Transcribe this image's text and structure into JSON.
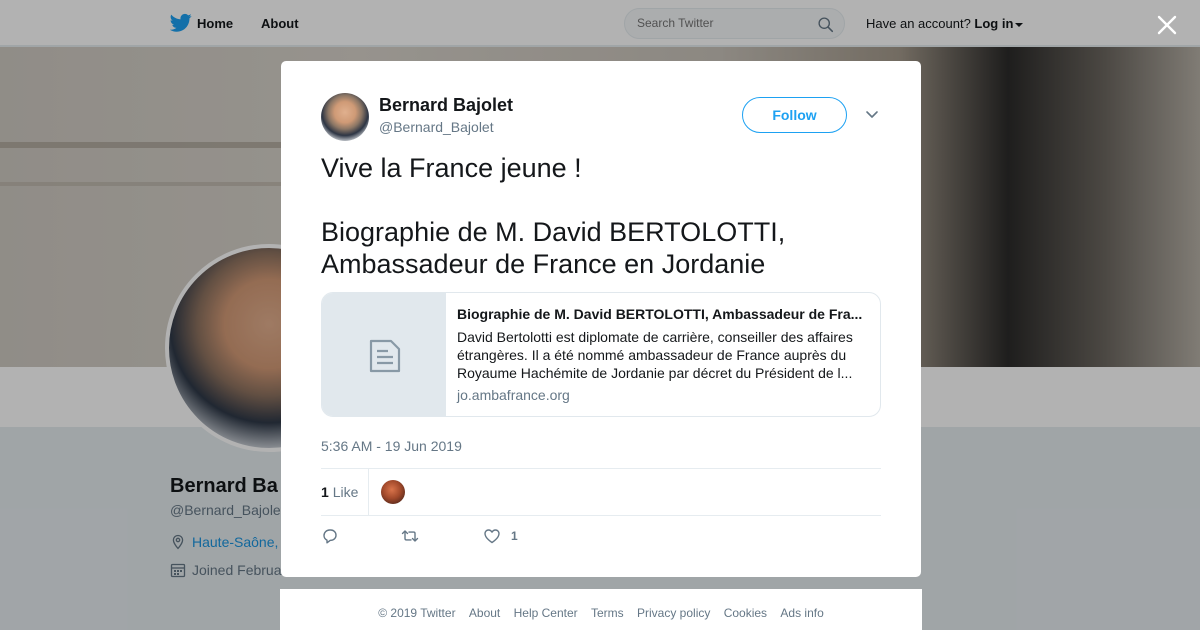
{
  "topnav": {
    "home_label": "Home",
    "about_label": "About",
    "search_placeholder": "Search Twitter",
    "account_prompt": "Have an account?",
    "login_label": "Log in"
  },
  "profile": {
    "name": "Bernard Ba",
    "handle": "@Bernard_Bajolet",
    "location": "Haute-Saône,",
    "joined": "Joined Februa"
  },
  "tweet": {
    "author_name": "Bernard Bajolet",
    "author_handle": "@Bernard_Bajolet",
    "follow_label": "Follow",
    "text": "Vive la France jeune !\n\nBiographie de M. David BERTOLOTTI, Ambassadeur de France en Jordanie",
    "card": {
      "title": "Biographie de M. David BERTOLOTTI, Ambassadeur de Fra...",
      "description": "David Bertolotti est diplomate de carrière, conseiller des affaires étrangères. Il a été nommé ambassadeur de France auprès du Royaume Hachémite de Jordanie par décret du Président de l...",
      "domain": "jo.ambafrance.org"
    },
    "timestamp": "5:36 AM - 19 Jun 2019",
    "likes_count": "1",
    "likes_label": "Like",
    "actions": {
      "reply_count": "",
      "retweet_count": "",
      "like_count": "1"
    }
  },
  "footer": {
    "links": [
      "© 2019 Twitter",
      "About",
      "Help Center",
      "Terms",
      "Privacy policy",
      "Cookies",
      "Ads info"
    ]
  },
  "colors": {
    "accent": "#1da1f2",
    "text_primary": "#14171a",
    "text_secondary": "#657786"
  },
  "icons": [
    "twitter-bird-icon",
    "search-icon",
    "close-icon",
    "chevron-down-icon",
    "document-icon",
    "reply-icon",
    "retweet-icon",
    "heart-icon",
    "location-icon",
    "calendar-icon"
  ]
}
